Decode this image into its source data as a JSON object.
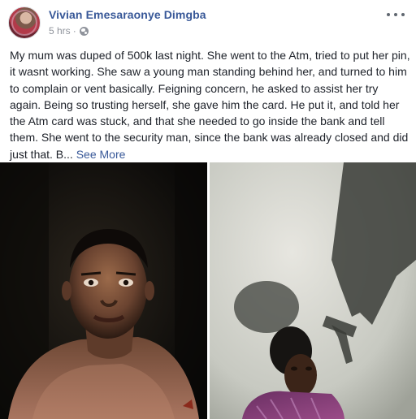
{
  "post": {
    "author": "Vivian Emesaraonye Dimgba",
    "time": "5 hrs",
    "separator": "·",
    "privacy_icon": "globe-icon",
    "menu_icon": "more-options-icon",
    "body": "My mum was duped of 500k last night. She went to the Atm, tried to put her pin, it wasnt working. She saw a young man standing behind her, and turned to him to complain or vent basically. Feigning concern, he asked to assist her try again. Being so trusting herself, she gave him the card. He put it, and told her the Atm card was stuck, and that she needed to go inside the bank and tell them. She went to the security man, since the bank was already closed and did just that. B...",
    "see_more": "See More"
  },
  "colors": {
    "name_link": "#385898",
    "meta_text": "#90949c",
    "body_text": "#1d2129"
  },
  "photos": [
    {
      "subject": "young man, bare-chested, in dark setting"
    },
    {
      "subject": "woman seated under shadow of rifle on wall"
    }
  ]
}
